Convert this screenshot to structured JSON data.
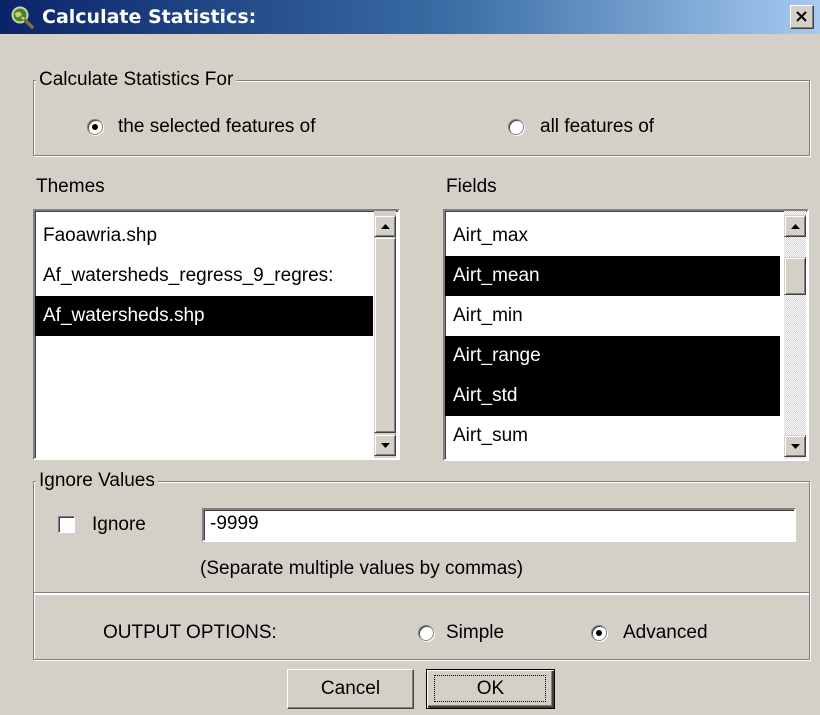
{
  "window": {
    "title": "Calculate Statistics:",
    "icon": "magnifier-globe-icon",
    "close_icon": "close-icon"
  },
  "calc_for": {
    "legend": "Calculate Statistics For",
    "options": [
      {
        "label": "the selected features of",
        "checked": true
      },
      {
        "label": "all features of",
        "checked": false
      }
    ]
  },
  "themes": {
    "label": "Themes",
    "items": [
      {
        "label": "Faoawria.shp",
        "selected": false
      },
      {
        "label": "Af_watersheds_regress_9_regres:",
        "selected": false
      },
      {
        "label": "Af_watersheds.shp",
        "selected": true
      }
    ]
  },
  "fields": {
    "label": "Fields",
    "items": [
      {
        "label": "Airt_max",
        "selected": false
      },
      {
        "label": "Airt_mean",
        "selected": true
      },
      {
        "label": "Airt_min",
        "selected": false
      },
      {
        "label": "Airt_range",
        "selected": true
      },
      {
        "label": "Airt_std",
        "selected": true
      },
      {
        "label": "Airt_sum",
        "selected": false
      }
    ]
  },
  "ignore": {
    "legend": "Ignore Values",
    "checkbox_label": "Ignore",
    "checked": false,
    "value": "-9999",
    "hint": "(Separate multiple values by commas)"
  },
  "output": {
    "label": "OUTPUT OPTIONS:",
    "options": [
      {
        "label": "Simple",
        "checked": false
      },
      {
        "label": "Advanced",
        "checked": true
      }
    ]
  },
  "buttons": {
    "cancel": "Cancel",
    "ok": "OK"
  },
  "colors": {
    "face": "#d4d0c8",
    "title_start": "#0a246a",
    "title_end": "#a6caf0",
    "selection": "#000000"
  }
}
